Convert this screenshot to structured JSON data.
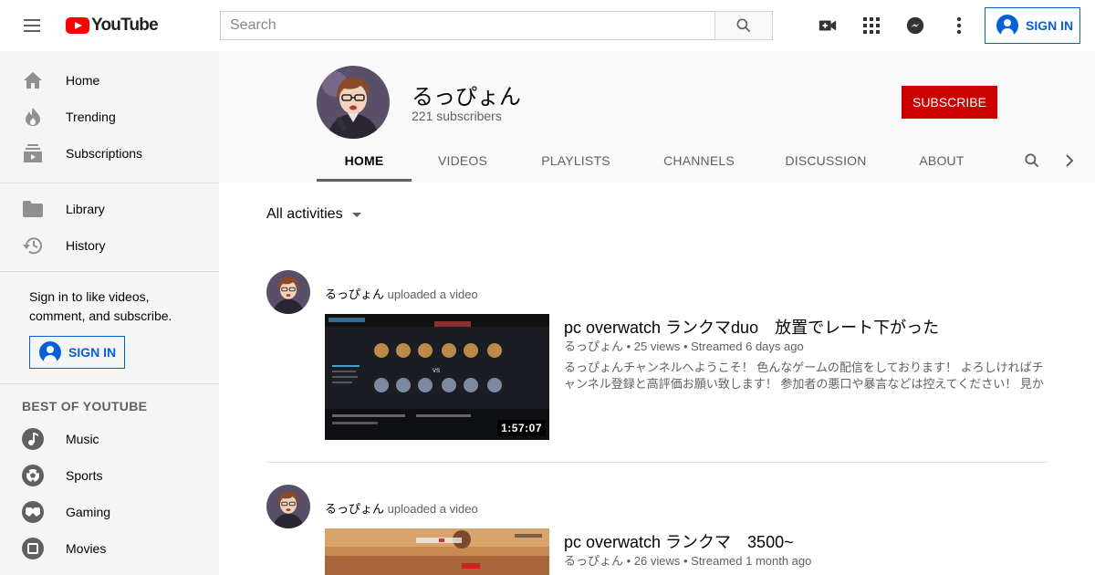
{
  "header": {
    "logo_text": "YouTube",
    "search_placeholder": "Search",
    "sign_in_label": "SIGN IN"
  },
  "sidebar": {
    "primary": [
      {
        "label": "Home",
        "icon": "home-icon"
      },
      {
        "label": "Trending",
        "icon": "flame-icon"
      },
      {
        "label": "Subscriptions",
        "icon": "subscriptions-icon"
      }
    ],
    "secondary": [
      {
        "label": "Library",
        "icon": "folder-icon"
      },
      {
        "label": "History",
        "icon": "history-icon"
      }
    ],
    "signin_prompt": "Sign in to like videos, comment, and subscribe.",
    "signin_label": "SIGN IN",
    "best_heading": "BEST OF YOUTUBE",
    "best": [
      {
        "label": "Music",
        "icon": "music-icon"
      },
      {
        "label": "Sports",
        "icon": "sports-icon"
      },
      {
        "label": "Gaming",
        "icon": "gaming-icon"
      },
      {
        "label": "Movies",
        "icon": "movies-icon"
      }
    ]
  },
  "channel": {
    "name": "るっぴょん",
    "subscribers": "221 subscribers",
    "subscribe_label": "SUBSCRIBE",
    "tabs": [
      "HOME",
      "VIDEOS",
      "PLAYLISTS",
      "CHANNELS",
      "DISCUSSION",
      "ABOUT"
    ],
    "active_tab": "HOME"
  },
  "feed": {
    "filter_label": "All activities",
    "items": [
      {
        "author": "るっぴょん",
        "action": "uploaded a video",
        "title": "pc overwatch ランクマduo　放置でレート下がった",
        "meta": "るっぴょん • 25 views • Streamed 6 days ago",
        "description": "るっぴょんチャンネルへようこそ！ 色んなゲームの配信をしております！ よろしければチャンネル登録と高評価お願い致します！ 参加者の悪口や暴言などは控えてください！ 見か",
        "duration": "1:57:07"
      },
      {
        "author": "るっぴょん",
        "action": "uploaded a video",
        "title": "pc overwatch ランクマ　3500~",
        "meta": "るっぴょん • 26 views • Streamed 1 month ago"
      }
    ]
  },
  "colors": {
    "brand_red": "#ff0000",
    "subscribe_red": "#cc0000",
    "link_blue": "#065fd4"
  }
}
